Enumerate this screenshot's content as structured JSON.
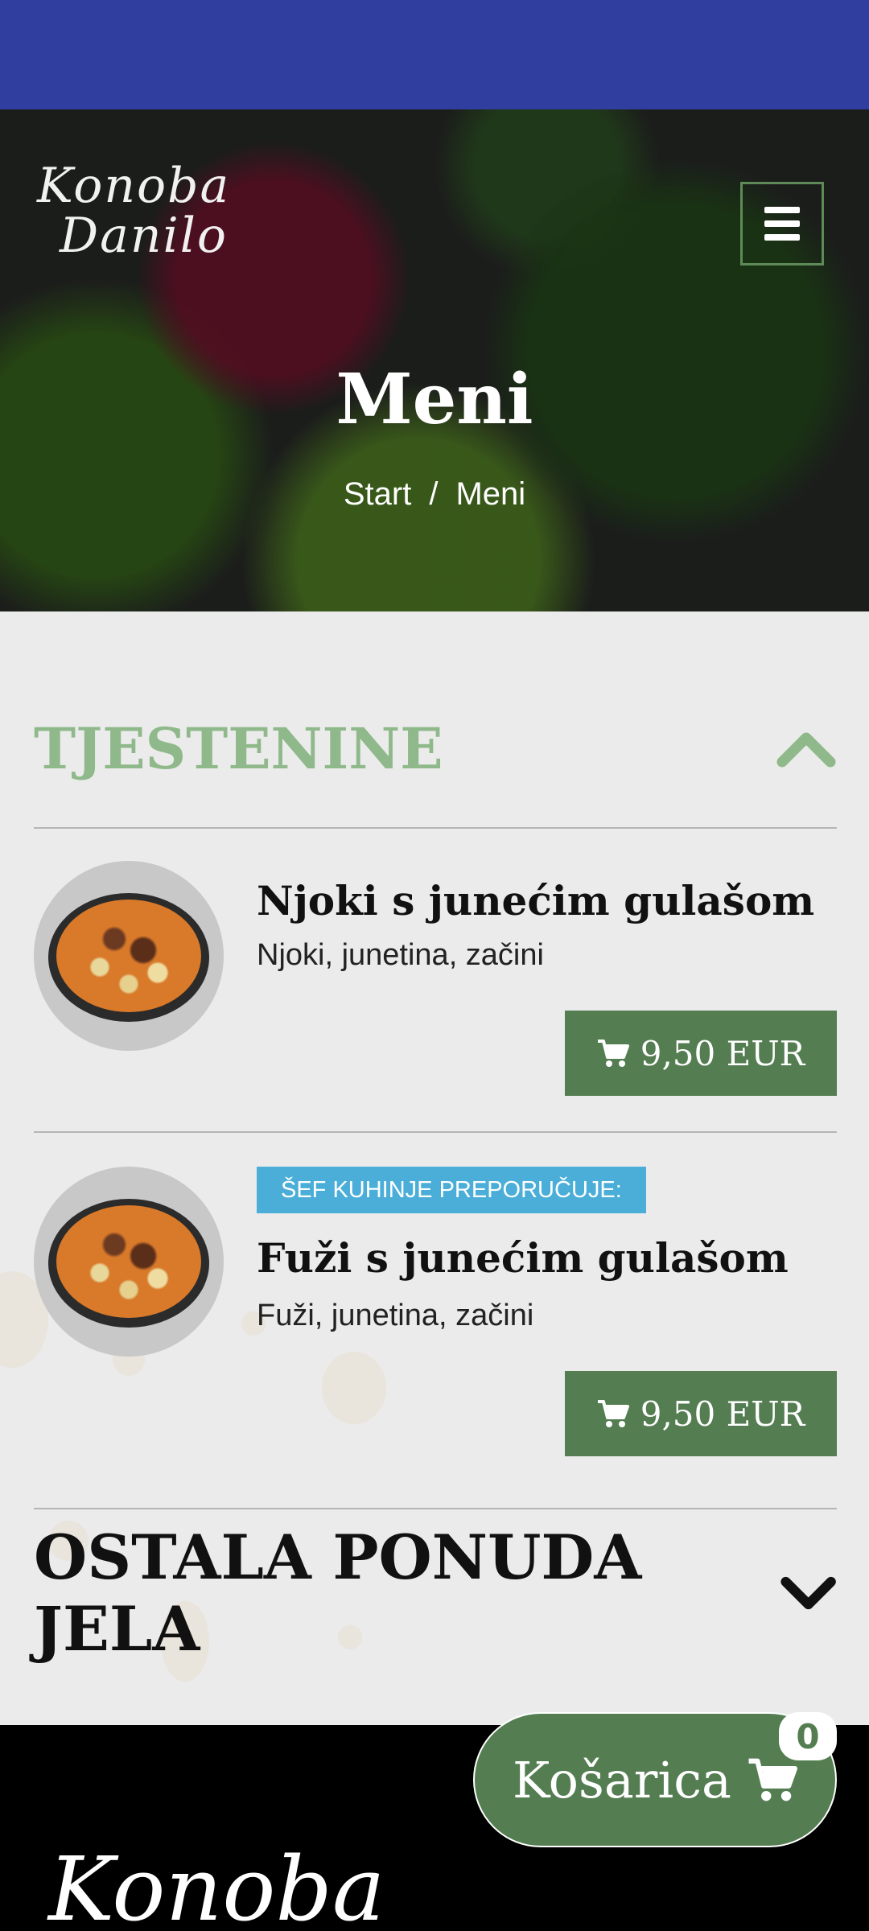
{
  "hero": {
    "logo_line1": "Konoba",
    "logo_line2": "Danilo",
    "title": "Meni",
    "breadcrumb": {
      "start": "Start",
      "separator": "/",
      "current": "Meni"
    }
  },
  "category": {
    "title": "TJESTENINE",
    "state_icon": "chevron-up-icon",
    "items": [
      {
        "name": "Njoki s junećim gulašom",
        "description": "Njoki, junetina, začini",
        "price": "9,50 EUR",
        "badge": ""
      },
      {
        "name": "Fuži s junećim gulašom",
        "description": "Fuži, junetina, začini",
        "price": "9,50 EUR",
        "badge": "ŠEF KUHINJE PREPORUČUJE:"
      }
    ]
  },
  "other": {
    "title": "OSTALA PONUDA JELA",
    "state_icon": "chevron-down-icon"
  },
  "cart": {
    "label": "Košarica",
    "count": "0"
  },
  "footer": {
    "script_fragment": "Konoba"
  },
  "colors": {
    "status_bar": "#303f9f",
    "accent_green": "#547e52",
    "category_green": "#8fb98a",
    "badge_blue": "#4aaed8",
    "background": "#ebebeb"
  }
}
